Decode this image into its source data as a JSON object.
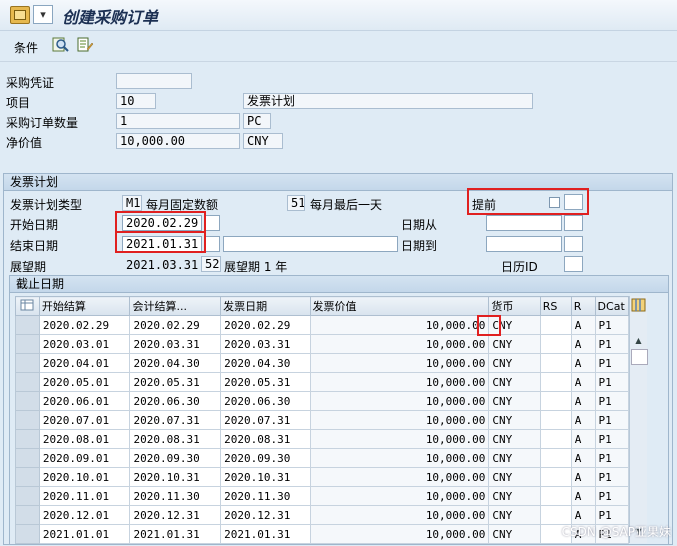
{
  "window": {
    "title": "创建采购订单"
  },
  "toolbar": {
    "conditions_label": "条件"
  },
  "header": {
    "po_label": "采购凭证",
    "po_value": "",
    "item_label": "项目",
    "item_value": "10",
    "item_text": "发票计划",
    "qty_label": "采购订单数量",
    "qty_value": "1",
    "qty_unit": "PC",
    "net_label": "净价值",
    "net_value": "10,000.00",
    "net_currency": "CNY"
  },
  "invoice_plan": {
    "group_title": "发票计划",
    "type_label": "发票计划类型",
    "type_code": "M1",
    "type_text": "每月固定数额",
    "day_code": "51",
    "day_text": "每月最后一天",
    "advance_label": "提前",
    "advance_checked": false,
    "start_label": "开始日期",
    "start_value": "2020.02.29",
    "date_from_label": "日期从",
    "date_from_value": "",
    "end_label": "结束日期",
    "end_value": "2021.01.31",
    "date_to_label": "日期到",
    "date_to_value": "",
    "horizon_label": "展望期",
    "horizon_date": "2021.03.31",
    "horizon_code": "52",
    "horizon_text": "展望期 1 年",
    "calendar_label": "日历ID",
    "calendar_value": ""
  },
  "deadline": {
    "group_title": "截止日期",
    "columns": [
      "开始结算",
      "会计结算...",
      "发票日期",
      "发票价值",
      "货币",
      "RS",
      "R",
      "DCat"
    ],
    "rows": [
      {
        "start": "2020.02.29",
        "acct": "2020.02.29",
        "inv": "2020.02.29",
        "value": "10,000.00",
        "cur": "CNY",
        "rs": "",
        "r": "A",
        "dcat": "P1"
      },
      {
        "start": "2020.03.01",
        "acct": "2020.03.31",
        "inv": "2020.03.31",
        "value": "10,000.00",
        "cur": "CNY",
        "rs": "",
        "r": "A",
        "dcat": "P1"
      },
      {
        "start": "2020.04.01",
        "acct": "2020.04.30",
        "inv": "2020.04.30",
        "value": "10,000.00",
        "cur": "CNY",
        "rs": "",
        "r": "A",
        "dcat": "P1"
      },
      {
        "start": "2020.05.01",
        "acct": "2020.05.31",
        "inv": "2020.05.31",
        "value": "10,000.00",
        "cur": "CNY",
        "rs": "",
        "r": "A",
        "dcat": "P1"
      },
      {
        "start": "2020.06.01",
        "acct": "2020.06.30",
        "inv": "2020.06.30",
        "value": "10,000.00",
        "cur": "CNY",
        "rs": "",
        "r": "A",
        "dcat": "P1"
      },
      {
        "start": "2020.07.01",
        "acct": "2020.07.31",
        "inv": "2020.07.31",
        "value": "10,000.00",
        "cur": "CNY",
        "rs": "",
        "r": "A",
        "dcat": "P1"
      },
      {
        "start": "2020.08.01",
        "acct": "2020.08.31",
        "inv": "2020.08.31",
        "value": "10,000.00",
        "cur": "CNY",
        "rs": "",
        "r": "A",
        "dcat": "P1"
      },
      {
        "start": "2020.09.01",
        "acct": "2020.09.30",
        "inv": "2020.09.30",
        "value": "10,000.00",
        "cur": "CNY",
        "rs": "",
        "r": "A",
        "dcat": "P1"
      },
      {
        "start": "2020.10.01",
        "acct": "2020.10.31",
        "inv": "2020.10.31",
        "value": "10,000.00",
        "cur": "CNY",
        "rs": "",
        "r": "A",
        "dcat": "P1"
      },
      {
        "start": "2020.11.01",
        "acct": "2020.11.30",
        "inv": "2020.11.30",
        "value": "10,000.00",
        "cur": "CNY",
        "rs": "",
        "r": "A",
        "dcat": "P1"
      },
      {
        "start": "2020.12.01",
        "acct": "2020.12.31",
        "inv": "2020.12.31",
        "value": "10,000.00",
        "cur": "CNY",
        "rs": "",
        "r": "A",
        "dcat": "P1"
      },
      {
        "start": "2021.01.01",
        "acct": "2021.01.31",
        "inv": "2021.01.31",
        "value": "10,000.00",
        "cur": "CNY",
        "rs": "",
        "r": "A",
        "dcat": "P1"
      }
    ]
  },
  "watermark": "CSDN @SAP亚果妹",
  "colors": {
    "highlight": "#e02020",
    "background": "#dfebf5"
  }
}
